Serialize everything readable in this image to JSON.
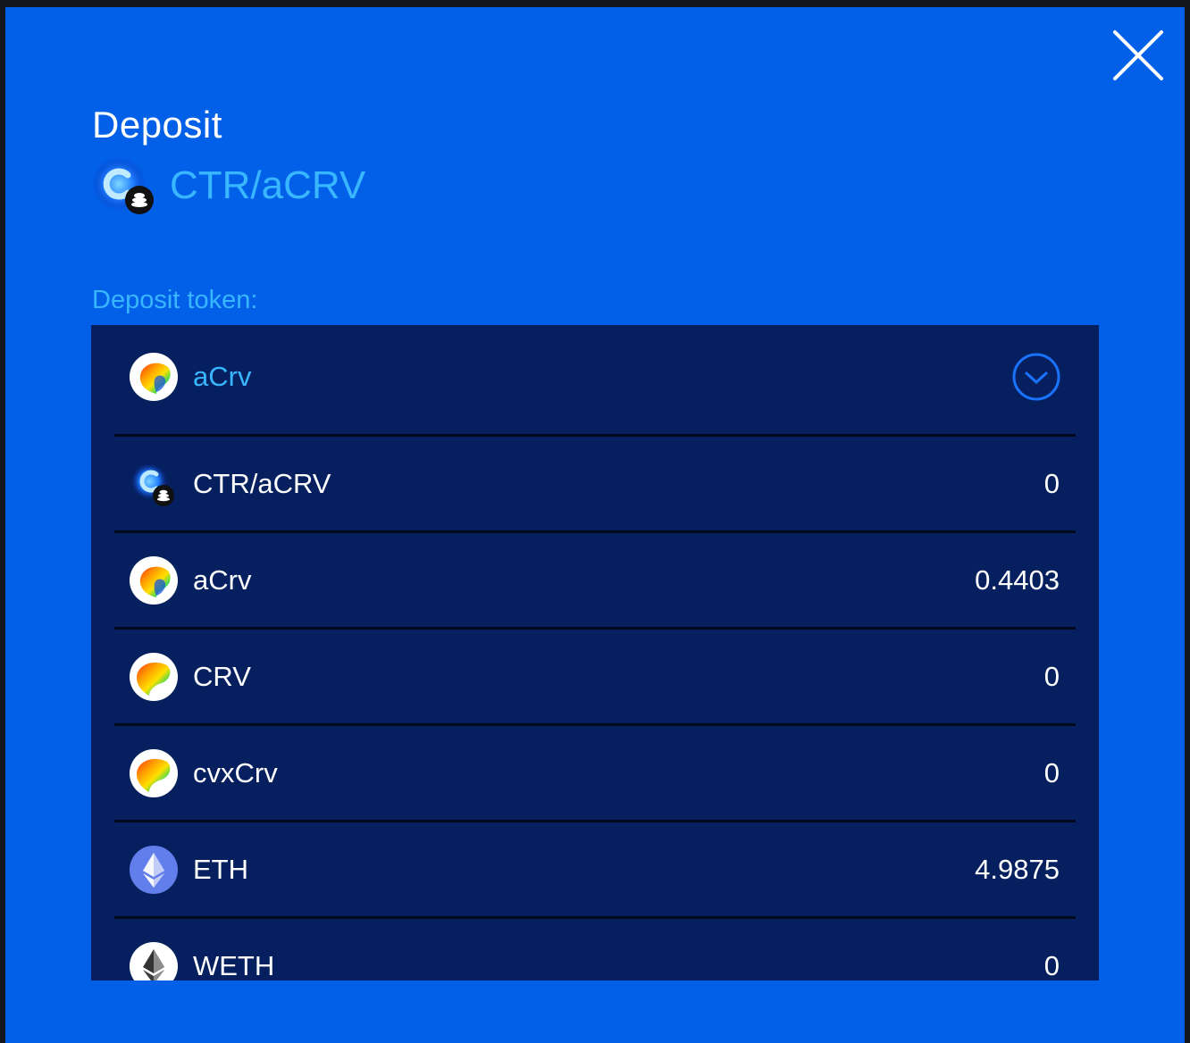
{
  "modal": {
    "title": "Deposit",
    "pool_name": "CTR/aCRV",
    "deposit_token_label": "Deposit token:"
  },
  "selected_token": {
    "name": "aCrv",
    "icon": "curve-logo-icon"
  },
  "tokens": [
    {
      "name": "CTR/aCRV",
      "balance": "0",
      "icon": "ctr-acrv-icon"
    },
    {
      "name": "aCrv",
      "balance": "0.4403",
      "icon": "curve-logo-icon"
    },
    {
      "name": "CRV",
      "balance": "0",
      "icon": "curve-logo-icon"
    },
    {
      "name": "cvxCrv",
      "balance": "0",
      "icon": "curve-logo-icon"
    },
    {
      "name": "ETH",
      "balance": "4.9875",
      "icon": "ethereum-icon"
    },
    {
      "name": "WETH",
      "balance": "0",
      "icon": "weth-icon"
    }
  ],
  "colors": {
    "modal_background": "#0260e8",
    "panel_background": "#06205f",
    "accent": "#38b6ff",
    "text": "#ffffff"
  }
}
